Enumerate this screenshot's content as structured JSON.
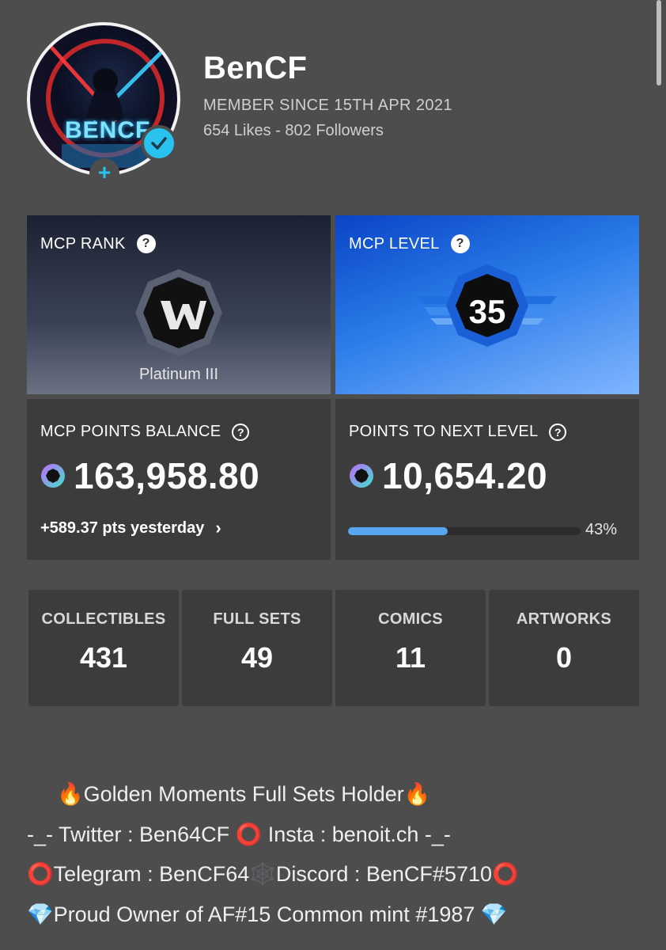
{
  "profile": {
    "username": "BenCF",
    "member_since": "MEMBER SINCE 15TH APR 2021",
    "stats_line": "654 Likes - 802 Followers",
    "avatar_text": "BENCF",
    "verified_icon": "check-icon",
    "add_icon": "plus-icon"
  },
  "rank_card": {
    "title": "MCP RANK",
    "rank_name": "Platinum III",
    "help_icon": "question-icon"
  },
  "level_card": {
    "title": "MCP LEVEL",
    "level": "35",
    "help_icon": "question-icon"
  },
  "balance_card": {
    "title": "MCP POINTS BALANCE",
    "value": "163,958.80",
    "yesterday": "+589.37 pts yesterday",
    "chevron": "›"
  },
  "next_level_card": {
    "title": "POINTS TO NEXT LEVEL",
    "value": "10,654.20",
    "progress_label": "43%",
    "progress_fraction": 0.43
  },
  "tiles": [
    {
      "label": "COLLECTIBLES",
      "value": "431"
    },
    {
      "label": "FULL SETS",
      "value": "49"
    },
    {
      "label": "COMICS",
      "value": "11"
    },
    {
      "label": "ARTWORKS",
      "value": "0"
    }
  ],
  "bio": [
    "🔥Golden Moments Full Sets Holder🔥",
    "-_- Twitter : Ben64CF ⭕ Insta : benoit.ch -_-",
    "⭕Telegram : BenCF64🕸️Discord : BenCF#5710⭕",
    "💎Proud Owner of AF#15 Common mint #1987 💎"
  ],
  "colors": {
    "background": "#4d4d4d",
    "card": "#3c3c3c",
    "accent": "#29c2ee",
    "progress": "#58a6f0",
    "level_blue": "#2a7be8"
  }
}
